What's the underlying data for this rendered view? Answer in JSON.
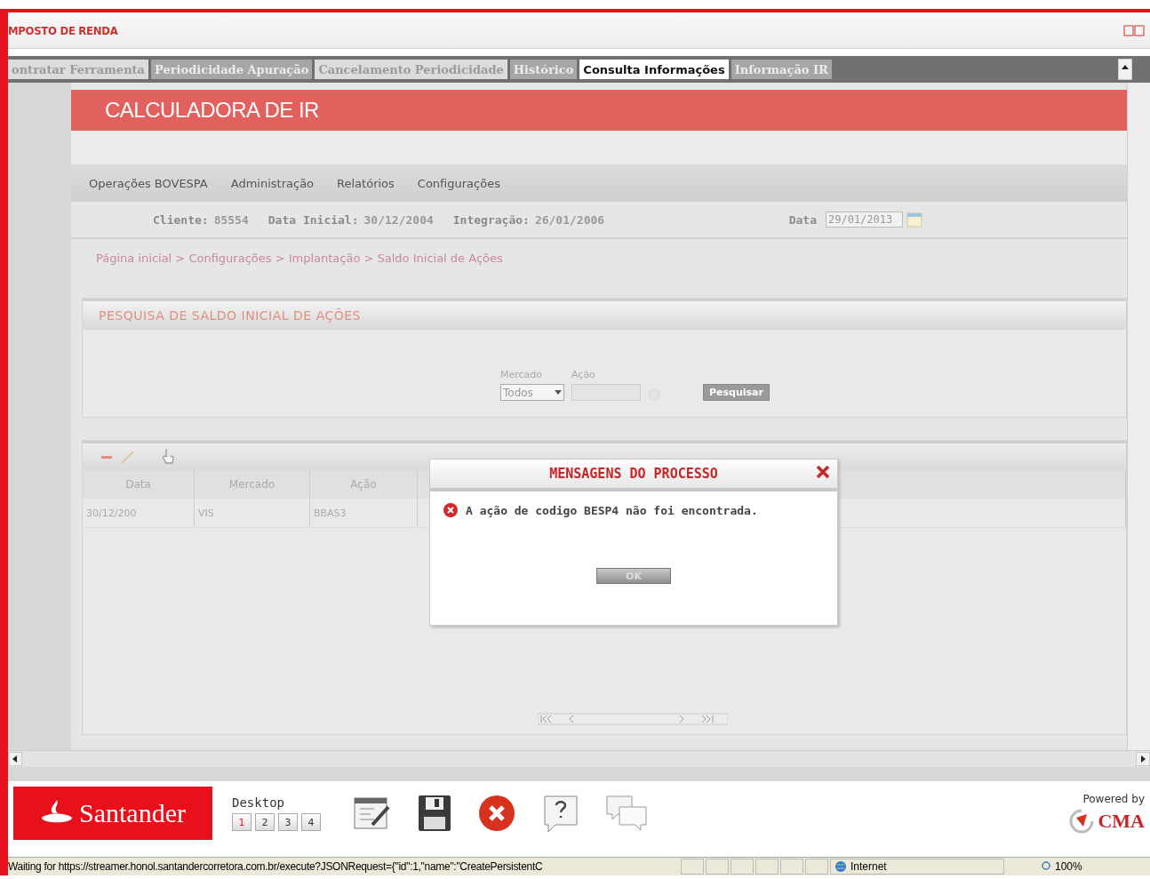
{
  "window": {
    "title": "MPOSTO DE RENDA"
  },
  "tabs": [
    {
      "label": "ontratar Ferramenta",
      "kind": "light",
      "selected": false
    },
    {
      "label": "Periodicidade Apuração",
      "kind": "dark",
      "selected": false
    },
    {
      "label": "Cancelamento Periodicidade",
      "kind": "light",
      "selected": false
    },
    {
      "label": "Histórico",
      "kind": "dark",
      "selected": false
    },
    {
      "label": "Consulta Informações",
      "kind": "light",
      "selected": true
    },
    {
      "label": "Informação IR",
      "kind": "dark",
      "selected": false
    }
  ],
  "header": {
    "title": "CALCULADORA DE IR"
  },
  "menu": [
    "Operações BOVESPA",
    "Administração",
    "Relatórios",
    "Configurações"
  ],
  "info": [
    {
      "label": "Cliente:",
      "value": "85554"
    },
    {
      "label": "Data Inicial:",
      "value": "30/12/2004"
    },
    {
      "label": "Integração:",
      "value": "26/01/2006"
    }
  ],
  "date": {
    "label": "Data",
    "value": "29/01/2013"
  },
  "breadcrumb": "Página inicial > Configurações > Implantação > Saldo Inicial de Ações",
  "search": {
    "title": "PESQUISA DE SALDO INICIAL DE AÇÕES",
    "market_label": "Mercado",
    "market_value": "Todos",
    "stock_label": "Ação",
    "button": "Pesquisar"
  },
  "grid": {
    "columns": [
      "Data",
      "Mercado",
      "Ação"
    ],
    "rows": [
      [
        "30/12/200",
        "VIS",
        "BBAS3"
      ]
    ]
  },
  "dialog": {
    "title": "MENSAGENS DO PROCESSO",
    "message": "A ação de codigo BESP4 não foi encontrada.",
    "button": "OK"
  },
  "taskbar": {
    "logo": "Santander",
    "desktop_label": "Desktop",
    "desktops": [
      {
        "label": "1",
        "selected": true
      },
      {
        "label": "2",
        "selected": false
      },
      {
        "label": "3",
        "selected": false
      },
      {
        "label": "4",
        "selected": false
      }
    ],
    "powered_by": "Powered by",
    "brand": "CMA"
  },
  "status_bar": {
    "text": "Waiting for https://streamer.honol.santandercorretora.com.br/execute?JSONRequest={\"id\":1,\"name\":\"CreatePersistentC",
    "zone": "Internet",
    "zoom": "100%"
  }
}
